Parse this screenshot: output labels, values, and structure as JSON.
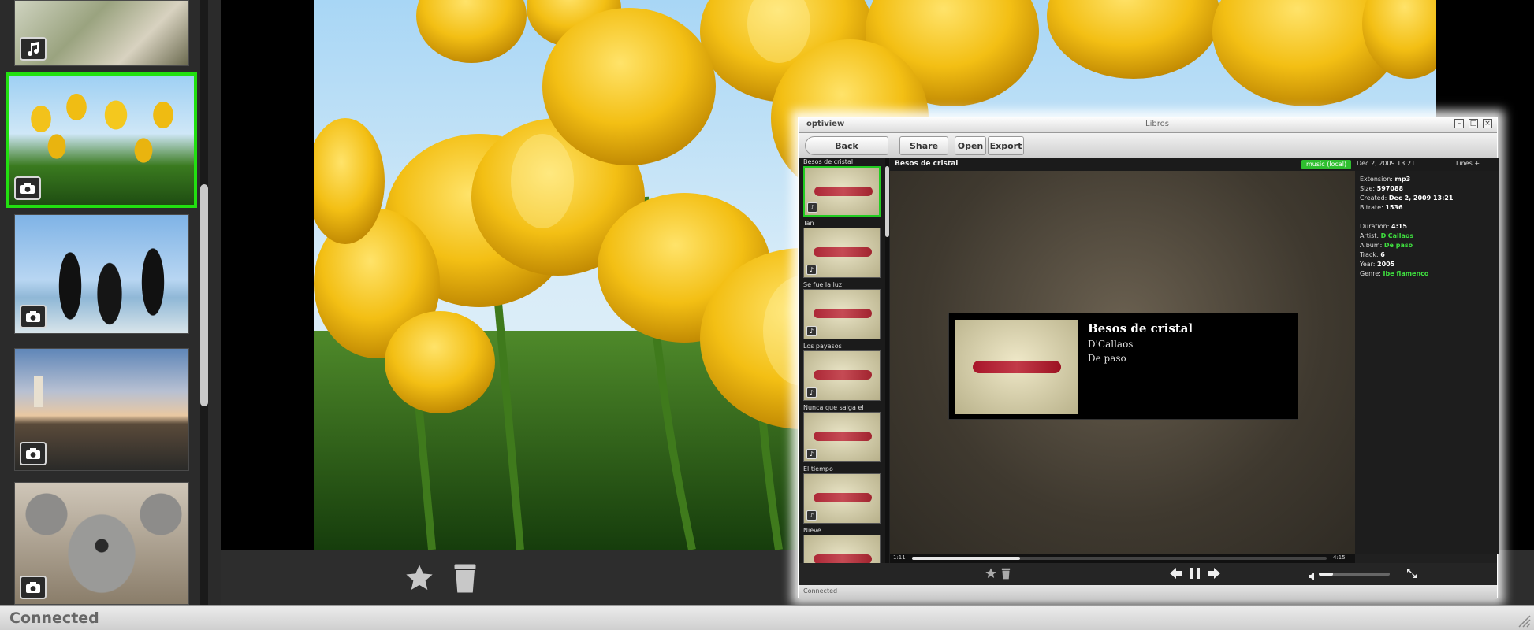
{
  "status_bar": {
    "text": "Connected"
  },
  "sidebar": {
    "items": [
      {
        "type": "music",
        "icon": "music-note-icon"
      },
      {
        "type": "photo",
        "icon": "camera-icon",
        "subject": "yellow tulips",
        "selected": true
      },
      {
        "type": "photo",
        "icon": "camera-icon",
        "subject": "penguins"
      },
      {
        "type": "photo",
        "icon": "camera-icon",
        "subject": "lighthouse"
      },
      {
        "type": "photo",
        "icon": "camera-icon",
        "subject": "koala"
      }
    ]
  },
  "viewer": {
    "toolbar": {
      "favorite_icon": "star-icon",
      "delete_icon": "trash-icon"
    }
  },
  "overlay": {
    "app_name": "optiview",
    "window_title": "Libros",
    "toolbar": {
      "back": "Back",
      "share": "Share",
      "open": "Open",
      "export": "Export"
    },
    "list": [
      {
        "title": "Besos de cristal",
        "selected": true
      },
      {
        "title": "Tan"
      },
      {
        "title": "Se fue la luz"
      },
      {
        "title": "Los payasos"
      },
      {
        "title": "Nunca que salga el"
      },
      {
        "title": "El tiempo"
      },
      {
        "title": "Nieve"
      }
    ],
    "header": {
      "title": "Besos de cristal",
      "badge": "music (local)",
      "date": "Dec 2, 2009 13:21",
      "view": "Lines +"
    },
    "now_playing": {
      "title": "Besos de cristal",
      "artist": "D'Callaos",
      "album": "De paso"
    },
    "info": {
      "extension_label": "Extension:",
      "extension": "mp3",
      "size_label": "Size:",
      "size": "597088",
      "created_label": "Created:",
      "created": "Dec 2, 2009 13:21",
      "bitrate_label": "Bitrate:",
      "bitrate": "1536",
      "duration_label": "Duration:",
      "duration": "4:15",
      "artist_label": "Artist:",
      "artist": "D'Callaos",
      "album_label": "Album:",
      "album": "De paso",
      "track_label": "Track:",
      "track": "6",
      "year_label": "Year:",
      "year": "2005",
      "genre_label": "Genre:",
      "genre": "Ibe flamenco"
    },
    "player": {
      "time_elapsed": "1:11",
      "time_total": "4:15",
      "progress": 0.26,
      "volume": 0.2
    },
    "status_text": "Connected"
  },
  "colors": {
    "accent_green": "#22e010",
    "sidebar_bg": "#2b2b2b",
    "toolbar_bg": "#2d2d2d"
  }
}
